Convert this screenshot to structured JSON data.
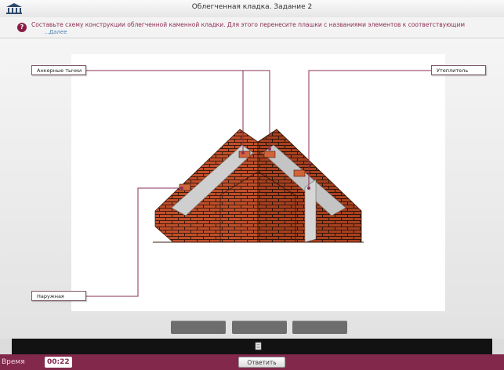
{
  "window": {
    "title": "Облегченная кладка. Задание 2",
    "logo_icon": "academy-logo-icon"
  },
  "task": {
    "help_icon": "question-icon",
    "text": "Составьте схему конструкции облегченной каменной кладки. Для этого перенесите плашки с названиями элементов к соответствующим",
    "more_link": "...Далее"
  },
  "labels": {
    "ankernye": "Анкерные тычки",
    "uteplitel": "Утеплитель",
    "naruzhnaya": "Наружная"
  },
  "answer_slots": [
    "",
    "",
    ""
  ],
  "footer": {
    "doc_icon": "document-icon",
    "time_label": "Время",
    "time_value": "00:22",
    "answer_button": "Ответить"
  },
  "colors": {
    "accent": "#82284b",
    "leader_line": "#8b2e57",
    "brick": "#c0512a",
    "mortar": "#c9c9c9"
  }
}
